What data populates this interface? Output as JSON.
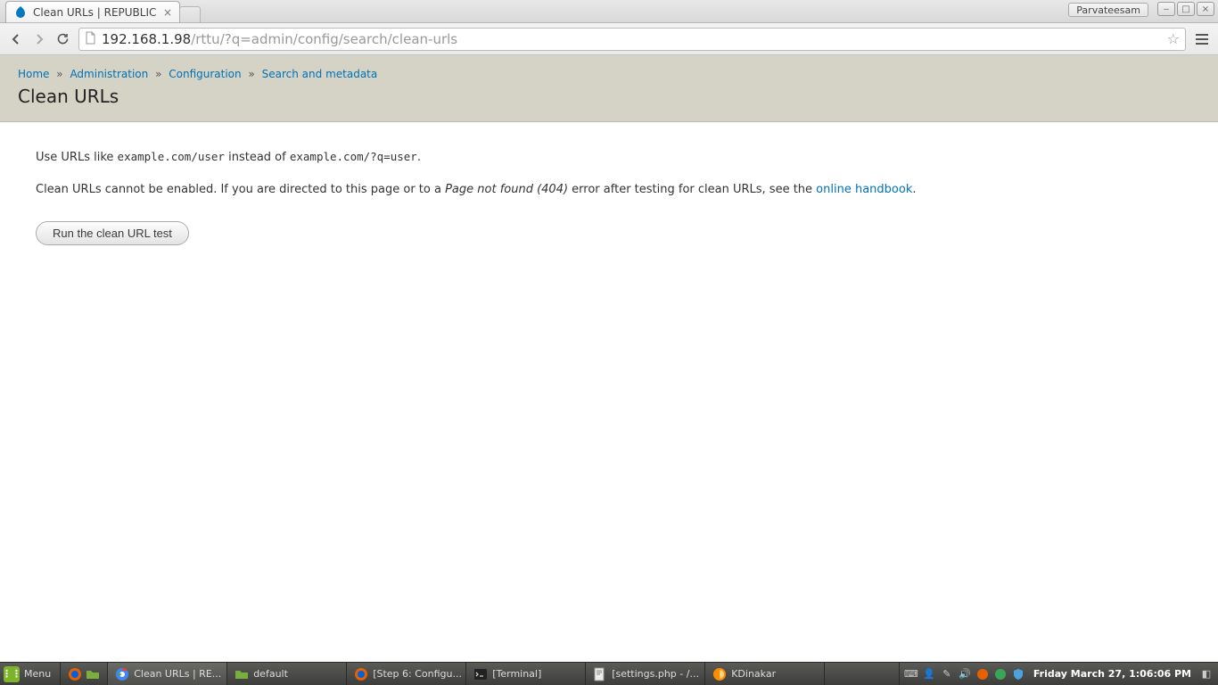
{
  "window": {
    "user_label": "Parvateesam",
    "tab_title": "Clean URLs | REPUBLIC"
  },
  "browser": {
    "url_host": "192.168.1.98",
    "url_path": "/rttu/?q=admin/config/search/clean-urls"
  },
  "breadcrumb": {
    "items": [
      "Home",
      "Administration",
      "Configuration",
      "Search and metadata"
    ]
  },
  "page": {
    "title": "Clean URLs",
    "intro_prefix": "Use URLs like ",
    "intro_code1": "example.com/user",
    "intro_mid": " instead of ",
    "intro_code2": "example.com/?q=user",
    "intro_suffix": ".",
    "warn_prefix": "Clean URLs cannot be enabled. If you are directed to this page or to a ",
    "warn_em": "Page not found (404)",
    "warn_mid": " error after testing for clean URLs, see the ",
    "warn_link": "online handbook",
    "warn_suffix": ".",
    "button_label": "Run the clean URL test"
  },
  "taskbar": {
    "menu_label": "Menu",
    "items": [
      {
        "label": "Clean URLs | RE...",
        "active": true
      },
      {
        "label": "default",
        "active": false
      },
      {
        "label": "[Step 6: Configu...",
        "active": false
      },
      {
        "label": "[Terminal]",
        "active": false
      },
      {
        "label": "[settings.php - /...",
        "active": false
      },
      {
        "label": "KDinakar",
        "active": false
      }
    ],
    "clock": "Friday March 27,  1:06:06 PM"
  }
}
